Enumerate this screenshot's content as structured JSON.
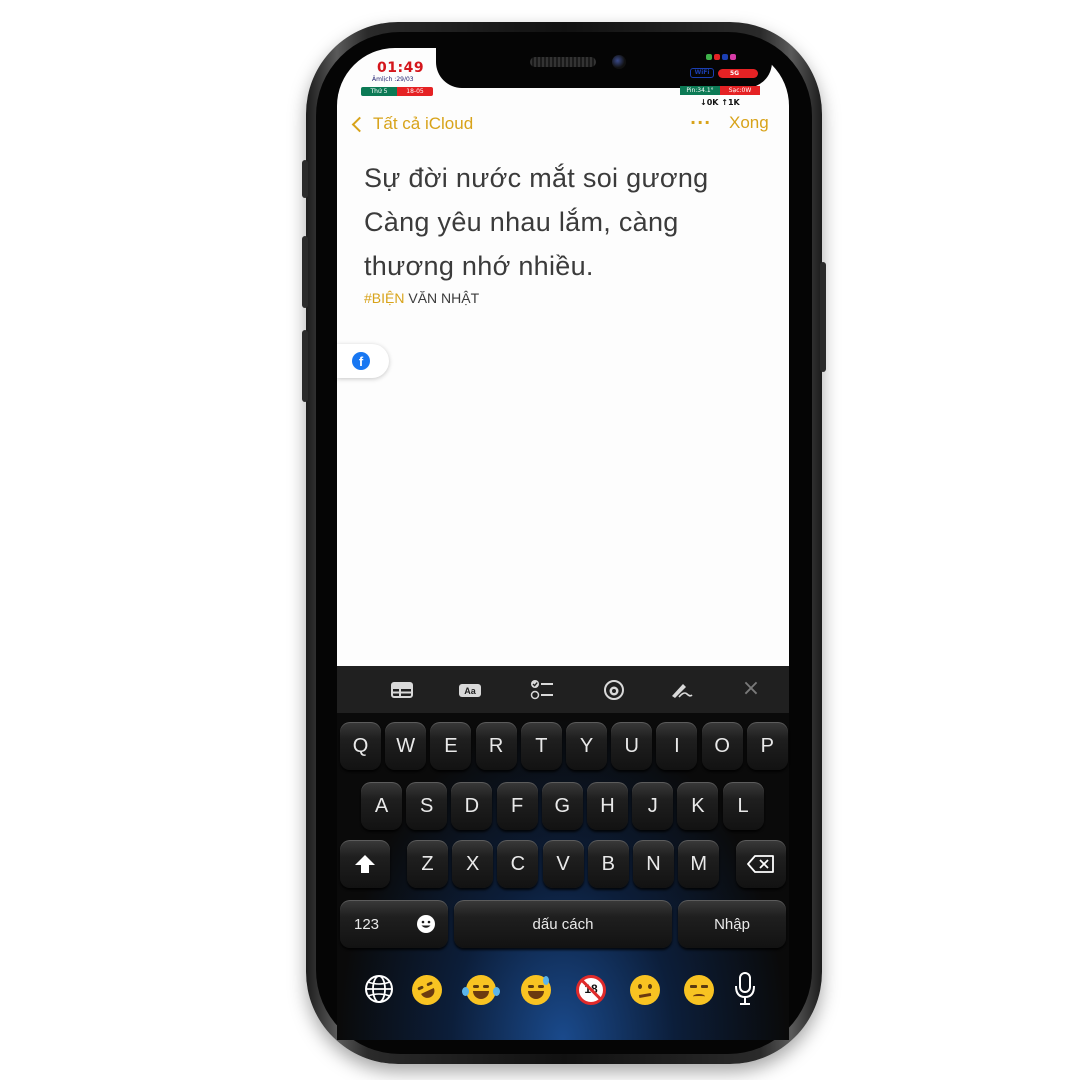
{
  "status": {
    "time": "01:49",
    "lunar": "Âmlịch :29/03",
    "weekday": "Thứ 5",
    "date": "18-05",
    "wifi": "WiFi",
    "signal": "5G",
    "battery_temp": "Pin:34.1°",
    "charge": "Sạc:0W",
    "net_speed": "↓0K ↑1K"
  },
  "nav": {
    "back_label": "Tất cả iCloud",
    "more_label": "···",
    "done_label": "Xong"
  },
  "note": {
    "line1": "Sự đời nước mắt soi gương",
    "line2": "Càng yêu nhau lắm, càng",
    "line3": "thương nhớ nhiều.",
    "tag_hash": "#BIỆN",
    "tag_name": " VĂN NHẬT"
  },
  "floating": {
    "icon": "facebook-icon",
    "glyph": "f"
  },
  "toolbar": {
    "items": [
      "table-icon",
      "text-format-icon",
      "checklist-icon",
      "camera-icon",
      "markup-icon",
      "close-icon"
    ],
    "close_glyph": "×"
  },
  "keyboard": {
    "row1": [
      "Q",
      "W",
      "E",
      "R",
      "T",
      "Y",
      "U",
      "I",
      "O",
      "P"
    ],
    "row2": [
      "A",
      "S",
      "D",
      "F",
      "G",
      "H",
      "J",
      "K",
      "L"
    ],
    "row3": [
      "Z",
      "X",
      "C",
      "V",
      "B",
      "N",
      "M"
    ],
    "numbers_label": "123",
    "space_label": "dấu cách",
    "return_label": "Nhập",
    "emoji_bar": [
      "rolling-laughing-emoji",
      "tears-of-joy-emoji",
      "sweat-smile-emoji",
      "no-under-18-emoji",
      "confused-emoji",
      "unamused-emoji"
    ],
    "no18_text": "18"
  },
  "colors": {
    "accent": "#d8a31a",
    "note_text": "#3b3b3b",
    "facebook": "#1877f2",
    "keyboard_bg": "#151515"
  }
}
